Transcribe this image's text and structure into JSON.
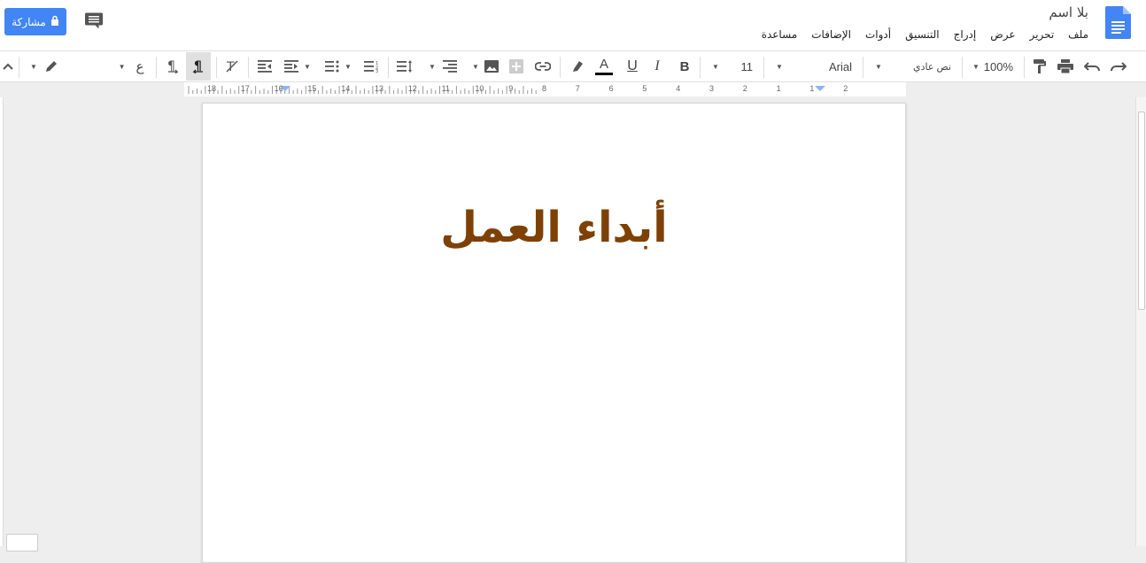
{
  "header": {
    "doc_title": "بلا اسم",
    "share_label": "مشاركة",
    "menu": [
      "ملف",
      "تحرير",
      "عرض",
      "إدراج",
      "التنسيق",
      "أدوات",
      "الإضافات",
      "مساعدة"
    ]
  },
  "toolbar": {
    "zoom": "100%",
    "style": "نص عادي",
    "font": "Arial",
    "font_size": "11",
    "input_lang": "ع",
    "text_color": "#000000"
  },
  "ruler": {
    "numbers": [
      "18",
      "17",
      "16",
      "15",
      "14",
      "13",
      "12",
      "11",
      "10",
      "9",
      "8",
      "7",
      "6",
      "5",
      "4",
      "3",
      "2",
      "1",
      "1",
      "2"
    ]
  },
  "document": {
    "heading": "أبداء العمل",
    "heading_color": "#7f4006"
  },
  "colors": {
    "accent": "#4285f4",
    "page_bg": "#ffffff",
    "canvas_bg": "#eeeeee"
  }
}
